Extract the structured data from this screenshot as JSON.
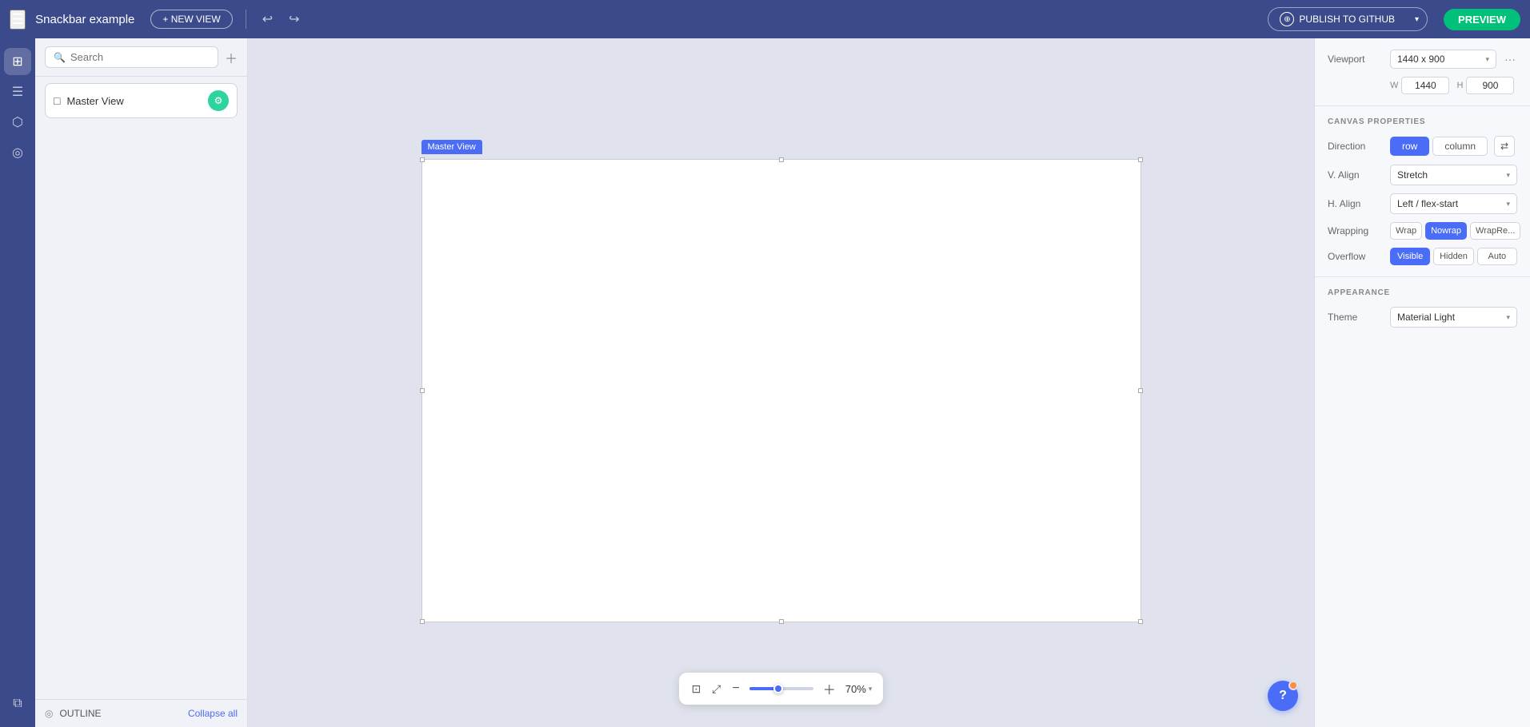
{
  "header": {
    "title": "Snackbar example",
    "new_view_label": "+ NEW VIEW",
    "publish_label": "PUBLISH TO GITHUB",
    "preview_label": "PREVIEW"
  },
  "left_sidebar": {
    "icons": [
      {
        "name": "grid-icon",
        "symbol": "⊞",
        "active": true
      },
      {
        "name": "layers-icon",
        "symbol": "☰",
        "active": false
      },
      {
        "name": "database-icon",
        "symbol": "⬡",
        "active": false
      },
      {
        "name": "theme-icon",
        "symbol": "◎",
        "active": false
      }
    ],
    "bottom_icons": [
      {
        "name": "layers-bottom-icon",
        "symbol": "⧉",
        "active": false
      }
    ]
  },
  "panel": {
    "search_placeholder": "Search",
    "layer_item": {
      "label": "Master View",
      "icon": "□"
    },
    "outline_label": "OUTLINE",
    "collapse_all_label": "Collapse all"
  },
  "canvas": {
    "frame_label": "Master View",
    "zoom_value": "70%"
  },
  "right_panel": {
    "viewport_label": "Viewport",
    "viewport_value": "1440 x 900",
    "w_label": "W",
    "w_value": "1440",
    "h_label": "H",
    "h_value": "900",
    "canvas_properties_title": "CANVAS PROPERTIES",
    "direction_label": "Direction",
    "direction_row_label": "row",
    "direction_column_label": "column",
    "v_align_label": "V. Align",
    "v_align_value": "Stretch",
    "h_align_label": "H. Align",
    "h_align_value": "Left / flex-start",
    "wrapping_label": "Wrapping",
    "wrap_label": "Wrap",
    "nowrap_label": "Nowrap",
    "wrapre_label": "WrapRe...",
    "overflow_label": "Overflow",
    "visible_label": "Visible",
    "hidden_label": "Hidden",
    "auto_label": "Auto",
    "appearance_title": "APPEARANCE",
    "theme_label": "Theme",
    "theme_value": "Material Light"
  }
}
